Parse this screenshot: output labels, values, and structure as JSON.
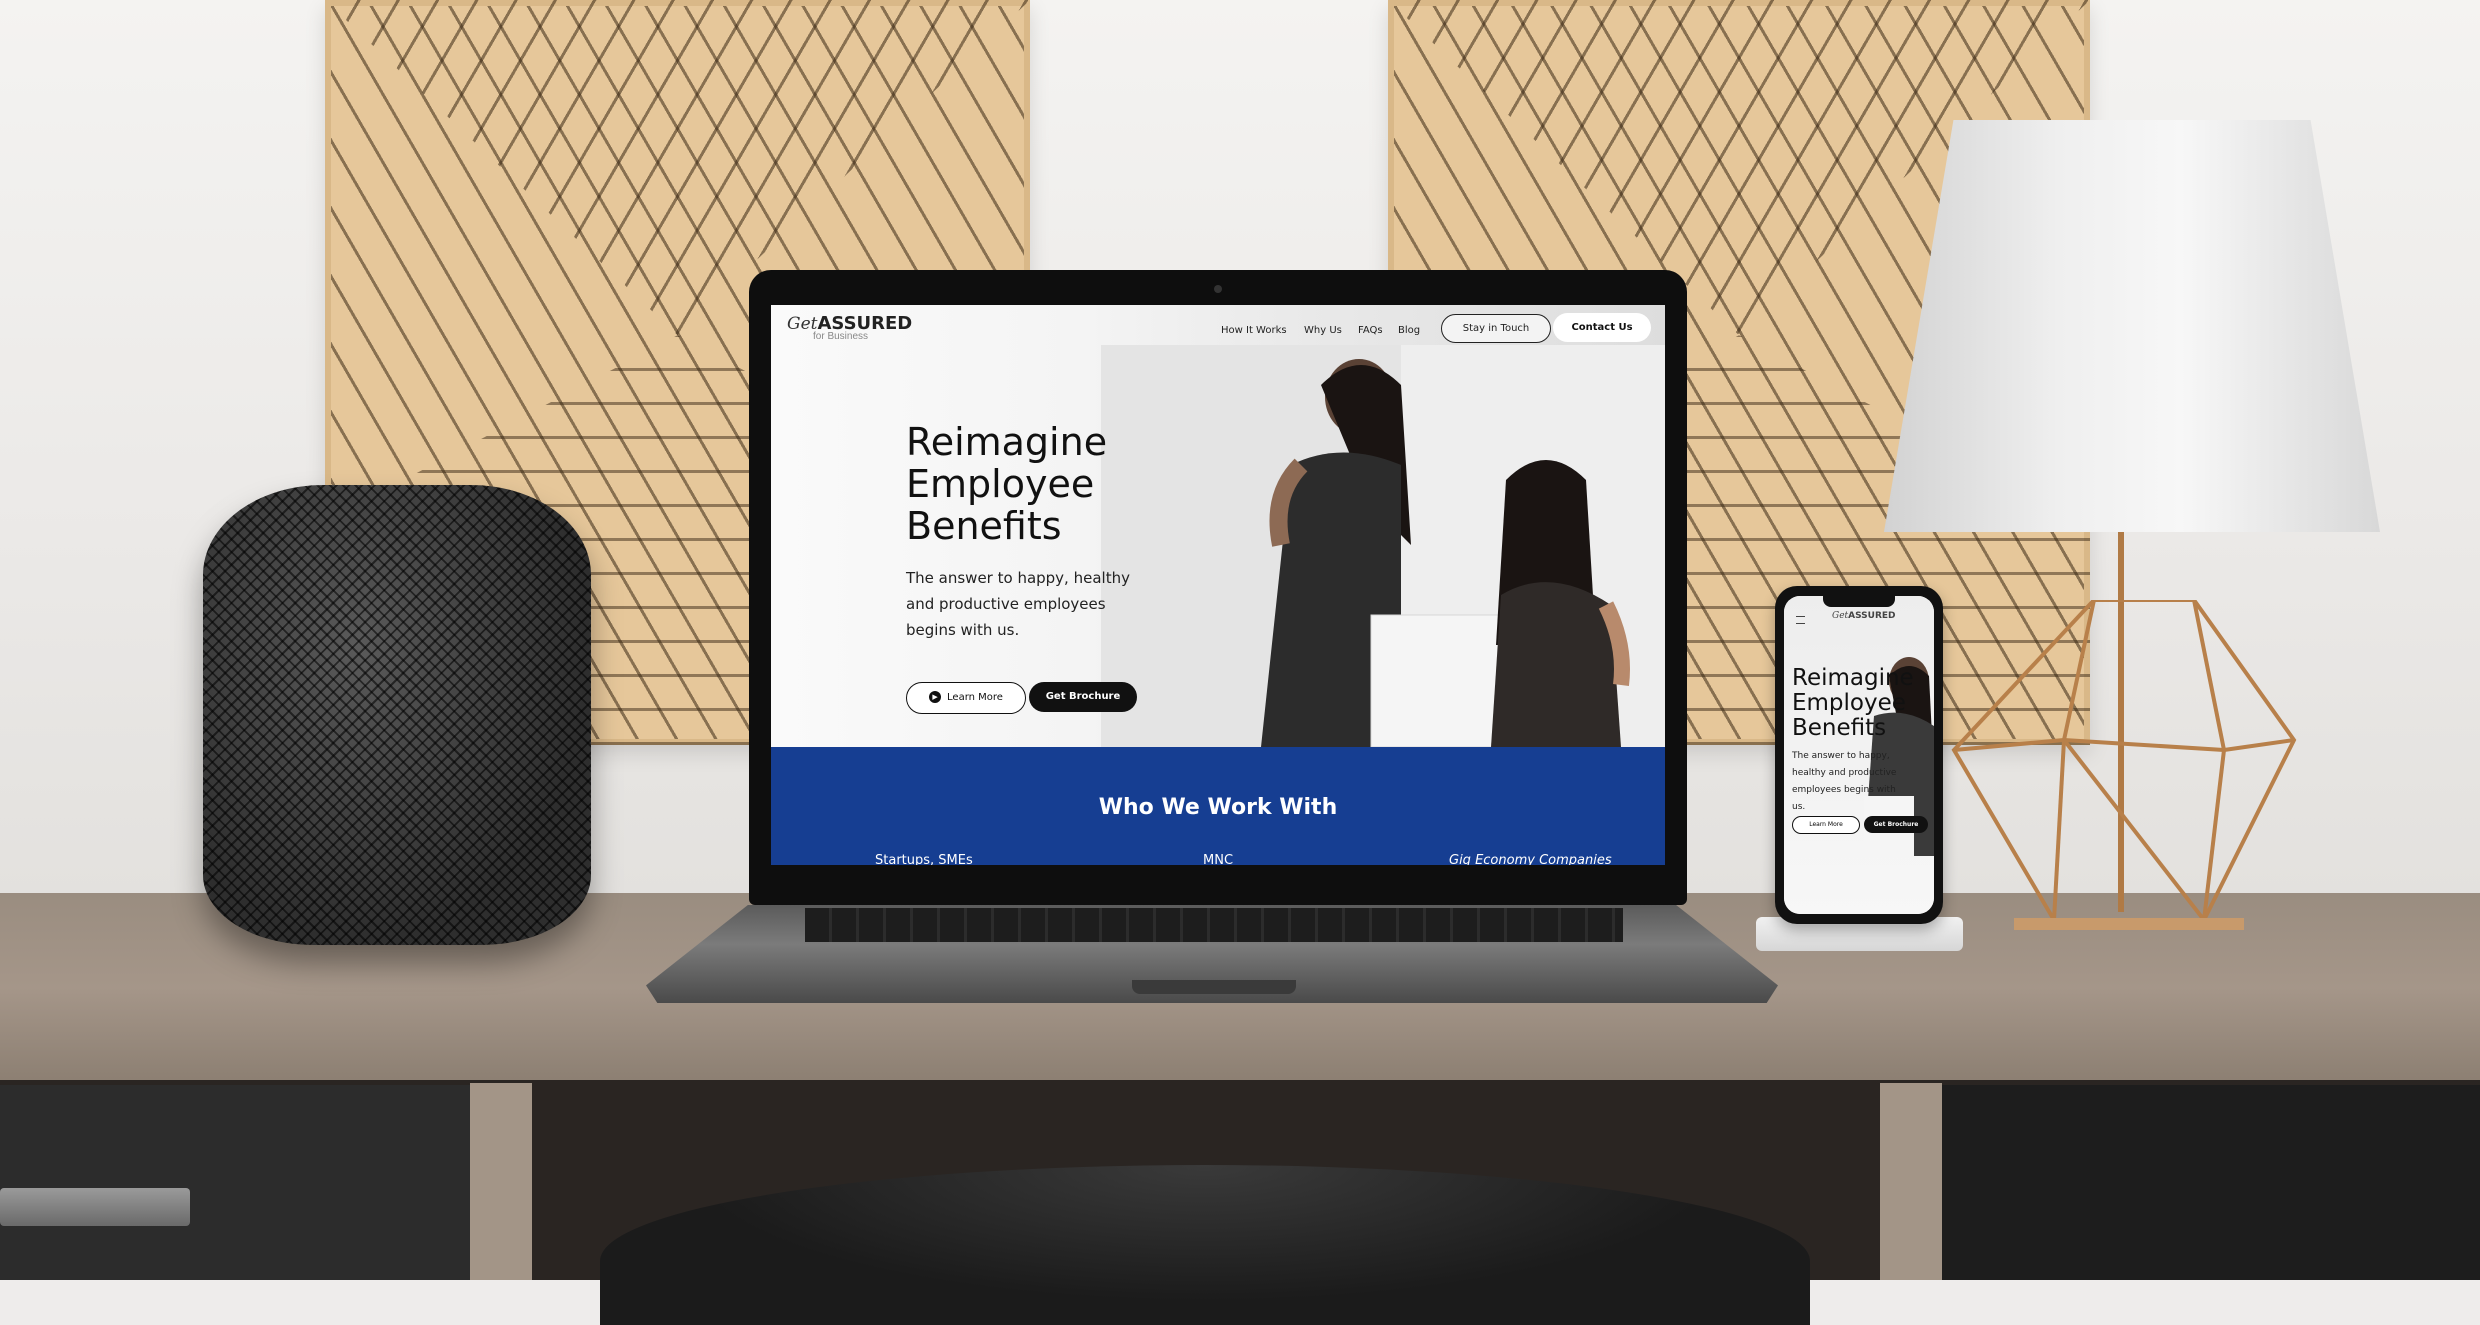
{
  "website": {
    "logo": {
      "get": "Get",
      "assured": "ASSURED",
      "sub": "for Business"
    },
    "nav": {
      "items": [
        "How It Works",
        "Why Us",
        "FAQs",
        "Blog"
      ],
      "stay_in_touch": "Stay in Touch",
      "contact_us": "Contact Us"
    },
    "hero": {
      "title_line1": "Reimagine",
      "title_line2": "Employee",
      "title_line3": "Benefits",
      "subtitle": "The answer to happy, healthy and productive employees begins with us.",
      "learn_more": "Learn More",
      "get_brochure": "Get Brochure"
    },
    "who_we_work_with": {
      "title": "Who We Work With",
      "items": [
        "Startups, SMEs",
        "MNC",
        "Gig Economy Companies"
      ]
    }
  },
  "colors": {
    "brand_blue": "#163e92",
    "button_dark": "#111111",
    "wood": "#e6c79a"
  },
  "icons": [
    "play-circle-icon",
    "hamburger-menu-icon"
  ]
}
